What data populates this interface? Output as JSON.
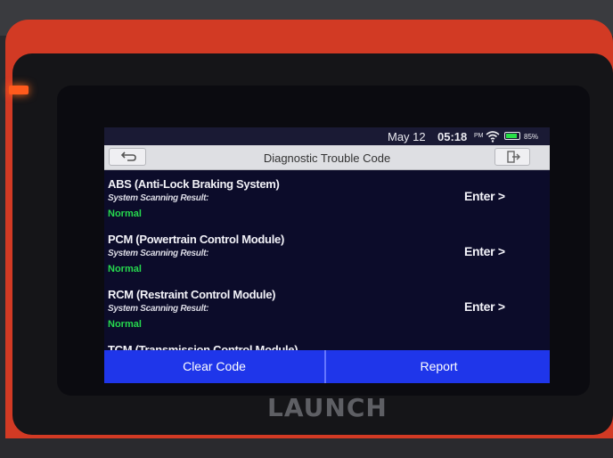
{
  "device": {
    "brand": "LAUNCH"
  },
  "status_bar": {
    "date": "May 12",
    "time": "05:18",
    "ampm": "PM",
    "battery": "85%",
    "battery_level": 0.85
  },
  "header": {
    "title": "Diagnostic Trouble Code",
    "back_icon": "back-arrow-icon",
    "exit_icon": "exit-icon"
  },
  "systems": [
    {
      "name": "ABS (Anti-Lock Braking System)",
      "scan_label": "System Scanning Result:",
      "result": "Normal",
      "action": "Enter >"
    },
    {
      "name": "PCM (Powertrain Control Module)",
      "scan_label": "System Scanning Result:",
      "result": "Normal",
      "action": "Enter >"
    },
    {
      "name": "RCM (Restraint Control Module)",
      "scan_label": "System Scanning Result:",
      "result": "Normal",
      "action": "Enter >"
    },
    {
      "name": "TCM (Transmission Control Module)"
    }
  ],
  "footer": {
    "clear_code": "Clear Code",
    "report": "Report"
  },
  "colors": {
    "accent": "#1f36ea",
    "normal": "#26d84e",
    "case": "#d23a24"
  }
}
